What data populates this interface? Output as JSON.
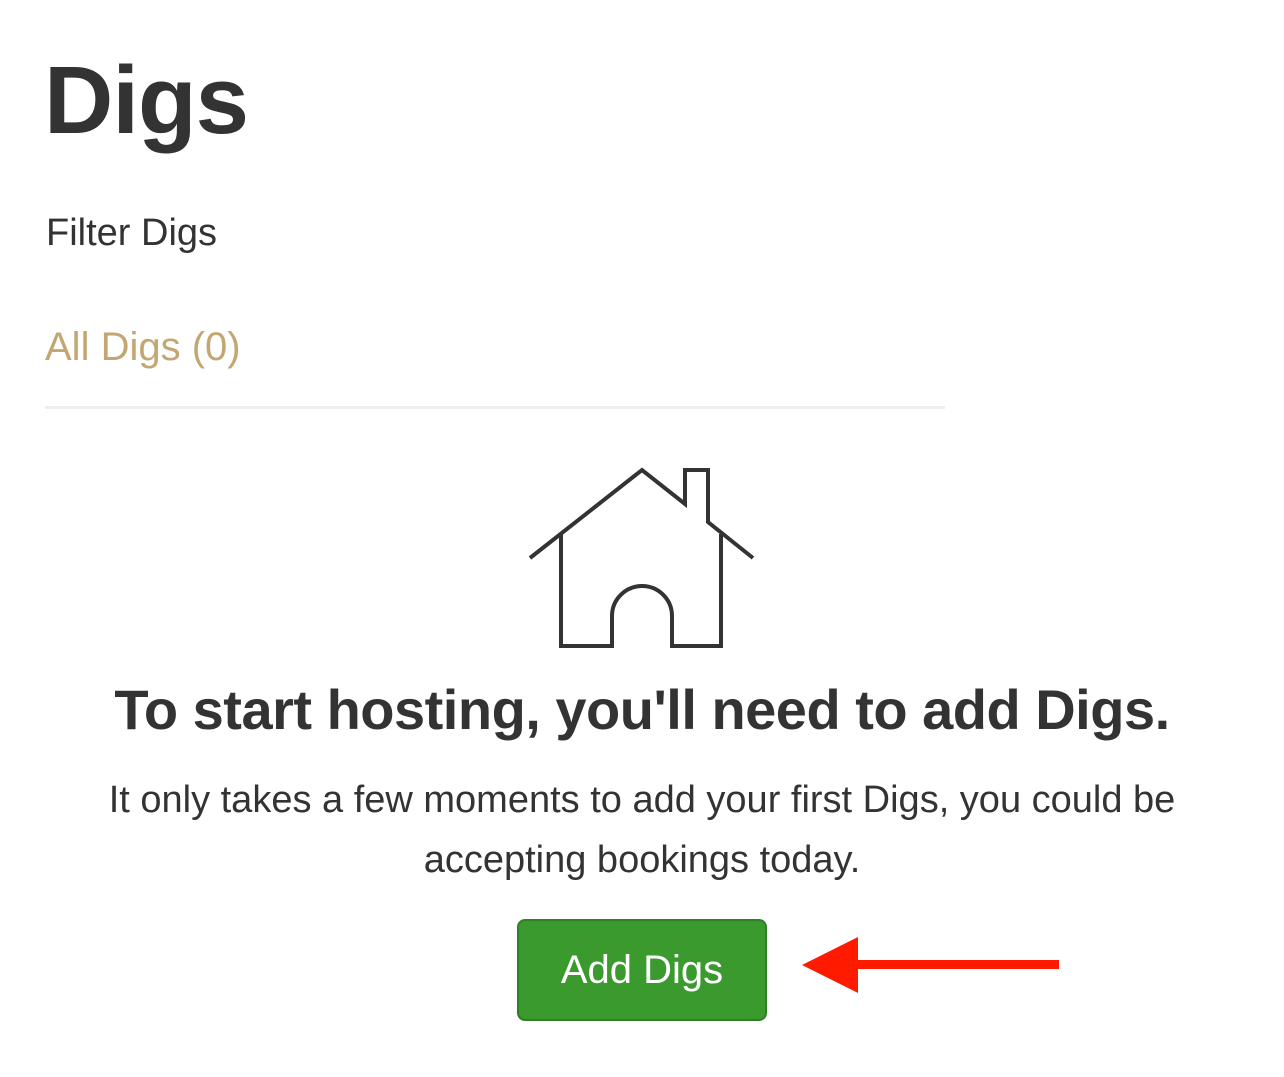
{
  "page": {
    "title": "Digs"
  },
  "filter": {
    "heading": "Filter Digs",
    "items": [
      {
        "label": "All Digs (0)"
      }
    ]
  },
  "empty_state": {
    "icon": "house-icon",
    "heading": "To start hosting, you'll need to add Digs.",
    "description": "It only takes a few moments to add your first Digs, you could be accepting bookings today.",
    "button_label": "Add Digs"
  },
  "annotation": {
    "icon": "arrow-left-icon",
    "color": "#ff1a00"
  },
  "colors": {
    "text": "#333333",
    "link": "#c2a773",
    "button": "#3b9a2e",
    "divider": "#eeeeee"
  }
}
